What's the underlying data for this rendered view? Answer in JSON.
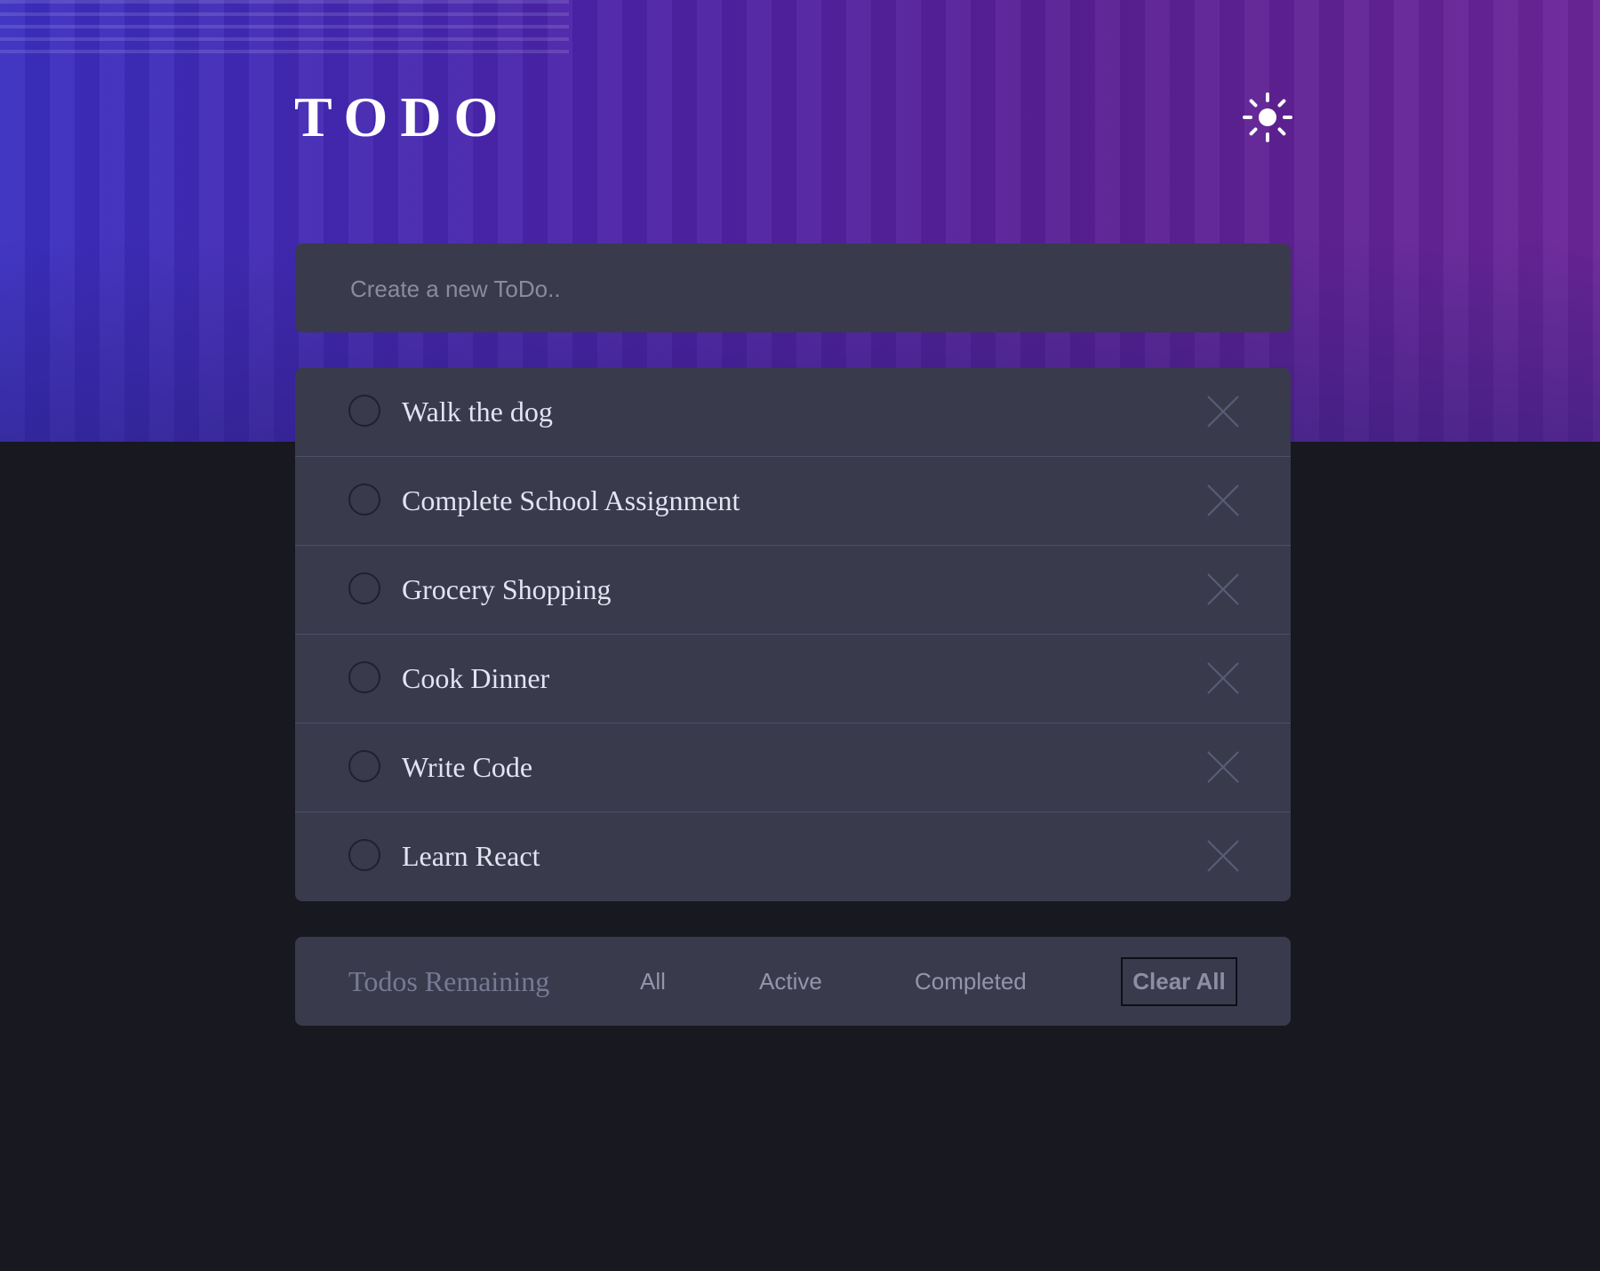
{
  "header": {
    "title": "TODO",
    "theme_toggle_icon": "sun-icon"
  },
  "new_todo": {
    "placeholder": "Create a new ToDo..",
    "value": ""
  },
  "todos": [
    {
      "text": "Walk the dog",
      "completed": false
    },
    {
      "text": "Complete School Assignment",
      "completed": false
    },
    {
      "text": "Grocery Shopping",
      "completed": false
    },
    {
      "text": "Cook Dinner",
      "completed": false
    },
    {
      "text": "Write Code",
      "completed": false
    },
    {
      "text": "Learn React",
      "completed": false
    }
  ],
  "footer": {
    "remaining_label": "Todos Remaining",
    "filters": [
      "All",
      "Active",
      "Completed"
    ],
    "clear_label": "Clear All"
  },
  "colors": {
    "page_background": "#181821",
    "panel_background": "#393a4c",
    "hero_gradient_start": "#3a2fc0",
    "hero_gradient_end": "#6a2598",
    "todo_text": "#e3e4f1",
    "muted_text": "#777a92"
  }
}
